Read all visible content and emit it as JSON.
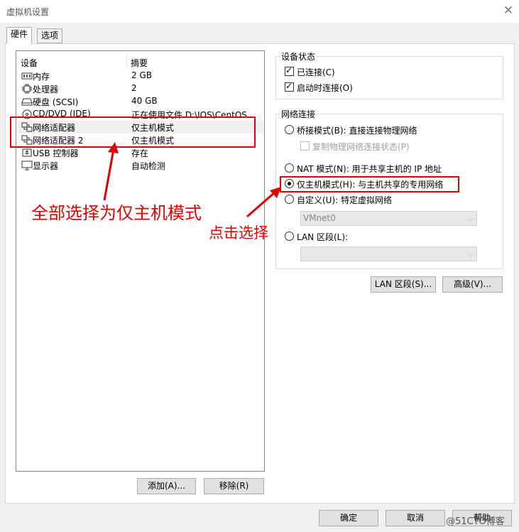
{
  "window": {
    "title": "虚拟机设置"
  },
  "tabs": [
    {
      "label": "硬件"
    },
    {
      "label": "选项"
    }
  ],
  "device_list": {
    "headers": {
      "device": "设备",
      "summary": "摘要"
    },
    "rows": [
      {
        "icon": "memory-icon",
        "name": "内存",
        "summary": "2 GB"
      },
      {
        "icon": "cpu-icon",
        "name": "处理器",
        "summary": "2"
      },
      {
        "icon": "hard-disk-icon",
        "name": "硬盘 (SCSI)",
        "summary": "40 GB"
      },
      {
        "icon": "cd-dvd-icon",
        "name": "CD/DVD (IDE)",
        "summary": "正在使用文件 D:\\IOS\\CentOS-..."
      },
      {
        "icon": "network-adapter-icon",
        "name": "网络适配器",
        "summary": "仅主机模式"
      },
      {
        "icon": "network-adapter-icon",
        "name": "网络适配器 2",
        "summary": "仅主机模式"
      },
      {
        "icon": "usb-controller-icon",
        "name": "USB 控制器",
        "summary": "存在"
      },
      {
        "icon": "display-icon",
        "name": "显示器",
        "summary": "自动检测"
      }
    ],
    "selected_index": 4
  },
  "list_buttons": {
    "add": "添加(A)...",
    "remove": "移除(R)"
  },
  "device_status": {
    "title": "设备状态",
    "connected": {
      "label": "已连接(C)",
      "checked": true
    },
    "connect_at_power_on": {
      "label": "启动时连接(O)",
      "checked": true
    }
  },
  "network_connection": {
    "title": "网络连接",
    "bridged": "桥接模式(B): 直接连接物理网络",
    "replicate": "复制物理网络连接状态(P)",
    "nat": "NAT 模式(N): 用于共享主机的 IP 地址",
    "host_only": "仅主机模式(H): 与主机共享的专用网络",
    "custom": "自定义(U): 特定虚拟网络",
    "custom_value": "VMnet0",
    "lan_segment": "LAN 区段(L):",
    "lan_segment_value": "",
    "selected": "host_only"
  },
  "right_buttons": {
    "lan_segments": "LAN 区段(S)...",
    "advanced": "高级(V)..."
  },
  "footer_buttons": {
    "ok": "确定",
    "cancel": "取消",
    "help": "帮助"
  },
  "annotations": {
    "select_all": "全部选择为仅主机模式",
    "click_select": "点击选择",
    "color": "#e00000"
  },
  "watermark": "@51CTO博客",
  "colors": {
    "dialog_bg": "#f0f0f0",
    "selection": "#f0f0f0",
    "annotation": "#e00000"
  }
}
